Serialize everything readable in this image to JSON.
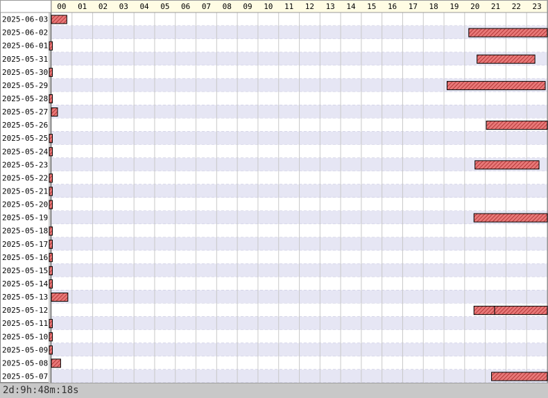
{
  "chart_data": {
    "type": "gantt",
    "x_label_hours": [
      "00",
      "01",
      "02",
      "03",
      "04",
      "05",
      "06",
      "07",
      "08",
      "09",
      "10",
      "11",
      "12",
      "13",
      "14",
      "15",
      "16",
      "17",
      "18",
      "19",
      "20",
      "21",
      "22",
      "23"
    ],
    "xlim": [
      0,
      24
    ],
    "rows": [
      {
        "date": "2025-06-03",
        "spans": [
          [
            0.0,
            0.75
          ]
        ]
      },
      {
        "date": "2025-06-02",
        "spans": [
          [
            20.2,
            24.0
          ]
        ]
      },
      {
        "date": "2025-06-01",
        "spans": [
          [
            0.0,
            0.1
          ]
        ]
      },
      {
        "date": "2025-05-31",
        "spans": [
          [
            20.6,
            23.4
          ]
        ]
      },
      {
        "date": "2025-05-30",
        "spans": [
          [
            0.0,
            0.1
          ]
        ]
      },
      {
        "date": "2025-05-29",
        "spans": [
          [
            19.15,
            23.9
          ]
        ]
      },
      {
        "date": "2025-05-28",
        "spans": [
          [
            0.0,
            0.1
          ]
        ]
      },
      {
        "date": "2025-05-27",
        "spans": [
          [
            0.0,
            0.3
          ]
        ]
      },
      {
        "date": "2025-05-26",
        "spans": [
          [
            21.05,
            24.0
          ]
        ]
      },
      {
        "date": "2025-05-25",
        "spans": [
          [
            0.0,
            0.1
          ]
        ]
      },
      {
        "date": "2025-05-24",
        "spans": [
          [
            0.0,
            0.1
          ]
        ]
      },
      {
        "date": "2025-05-23",
        "spans": [
          [
            20.5,
            23.6
          ]
        ]
      },
      {
        "date": "2025-05-22",
        "spans": [
          [
            0.0,
            0.1
          ]
        ]
      },
      {
        "date": "2025-05-21",
        "spans": [
          [
            0.0,
            0.1
          ]
        ]
      },
      {
        "date": "2025-05-20",
        "spans": [
          [
            0.0,
            0.1
          ]
        ]
      },
      {
        "date": "2025-05-19",
        "spans": [
          [
            20.45,
            24.0
          ]
        ]
      },
      {
        "date": "2025-05-18",
        "spans": [
          [
            0.0,
            0.1
          ]
        ]
      },
      {
        "date": "2025-05-17",
        "spans": [
          [
            0.0,
            0.1
          ]
        ]
      },
      {
        "date": "2025-05-16",
        "spans": [
          [
            0.0,
            0.1
          ]
        ]
      },
      {
        "date": "2025-05-15",
        "spans": [
          [
            0.0,
            0.1
          ]
        ]
      },
      {
        "date": "2025-05-14",
        "spans": [
          [
            0.0,
            0.1
          ]
        ]
      },
      {
        "date": "2025-05-13",
        "spans": [
          [
            0.0,
            0.8
          ]
        ]
      },
      {
        "date": "2025-05-12",
        "spans": [
          [
            20.45,
            21.45
          ],
          [
            21.45,
            24.0
          ]
        ]
      },
      {
        "date": "2025-05-11",
        "spans": [
          [
            0.0,
            0.1
          ]
        ]
      },
      {
        "date": "2025-05-10",
        "spans": [
          [
            0.0,
            0.1
          ]
        ]
      },
      {
        "date": "2025-05-09",
        "spans": [
          [
            0.0,
            0.1
          ]
        ]
      },
      {
        "date": "2025-05-08",
        "spans": [
          [
            0.0,
            0.45
          ]
        ]
      },
      {
        "date": "2025-05-07",
        "spans": [
          [
            21.3,
            24.0
          ]
        ]
      }
    ],
    "grid": true,
    "bar_color": "#e06060"
  },
  "footer": {
    "total_duration": "2d:9h:48m:18s"
  }
}
